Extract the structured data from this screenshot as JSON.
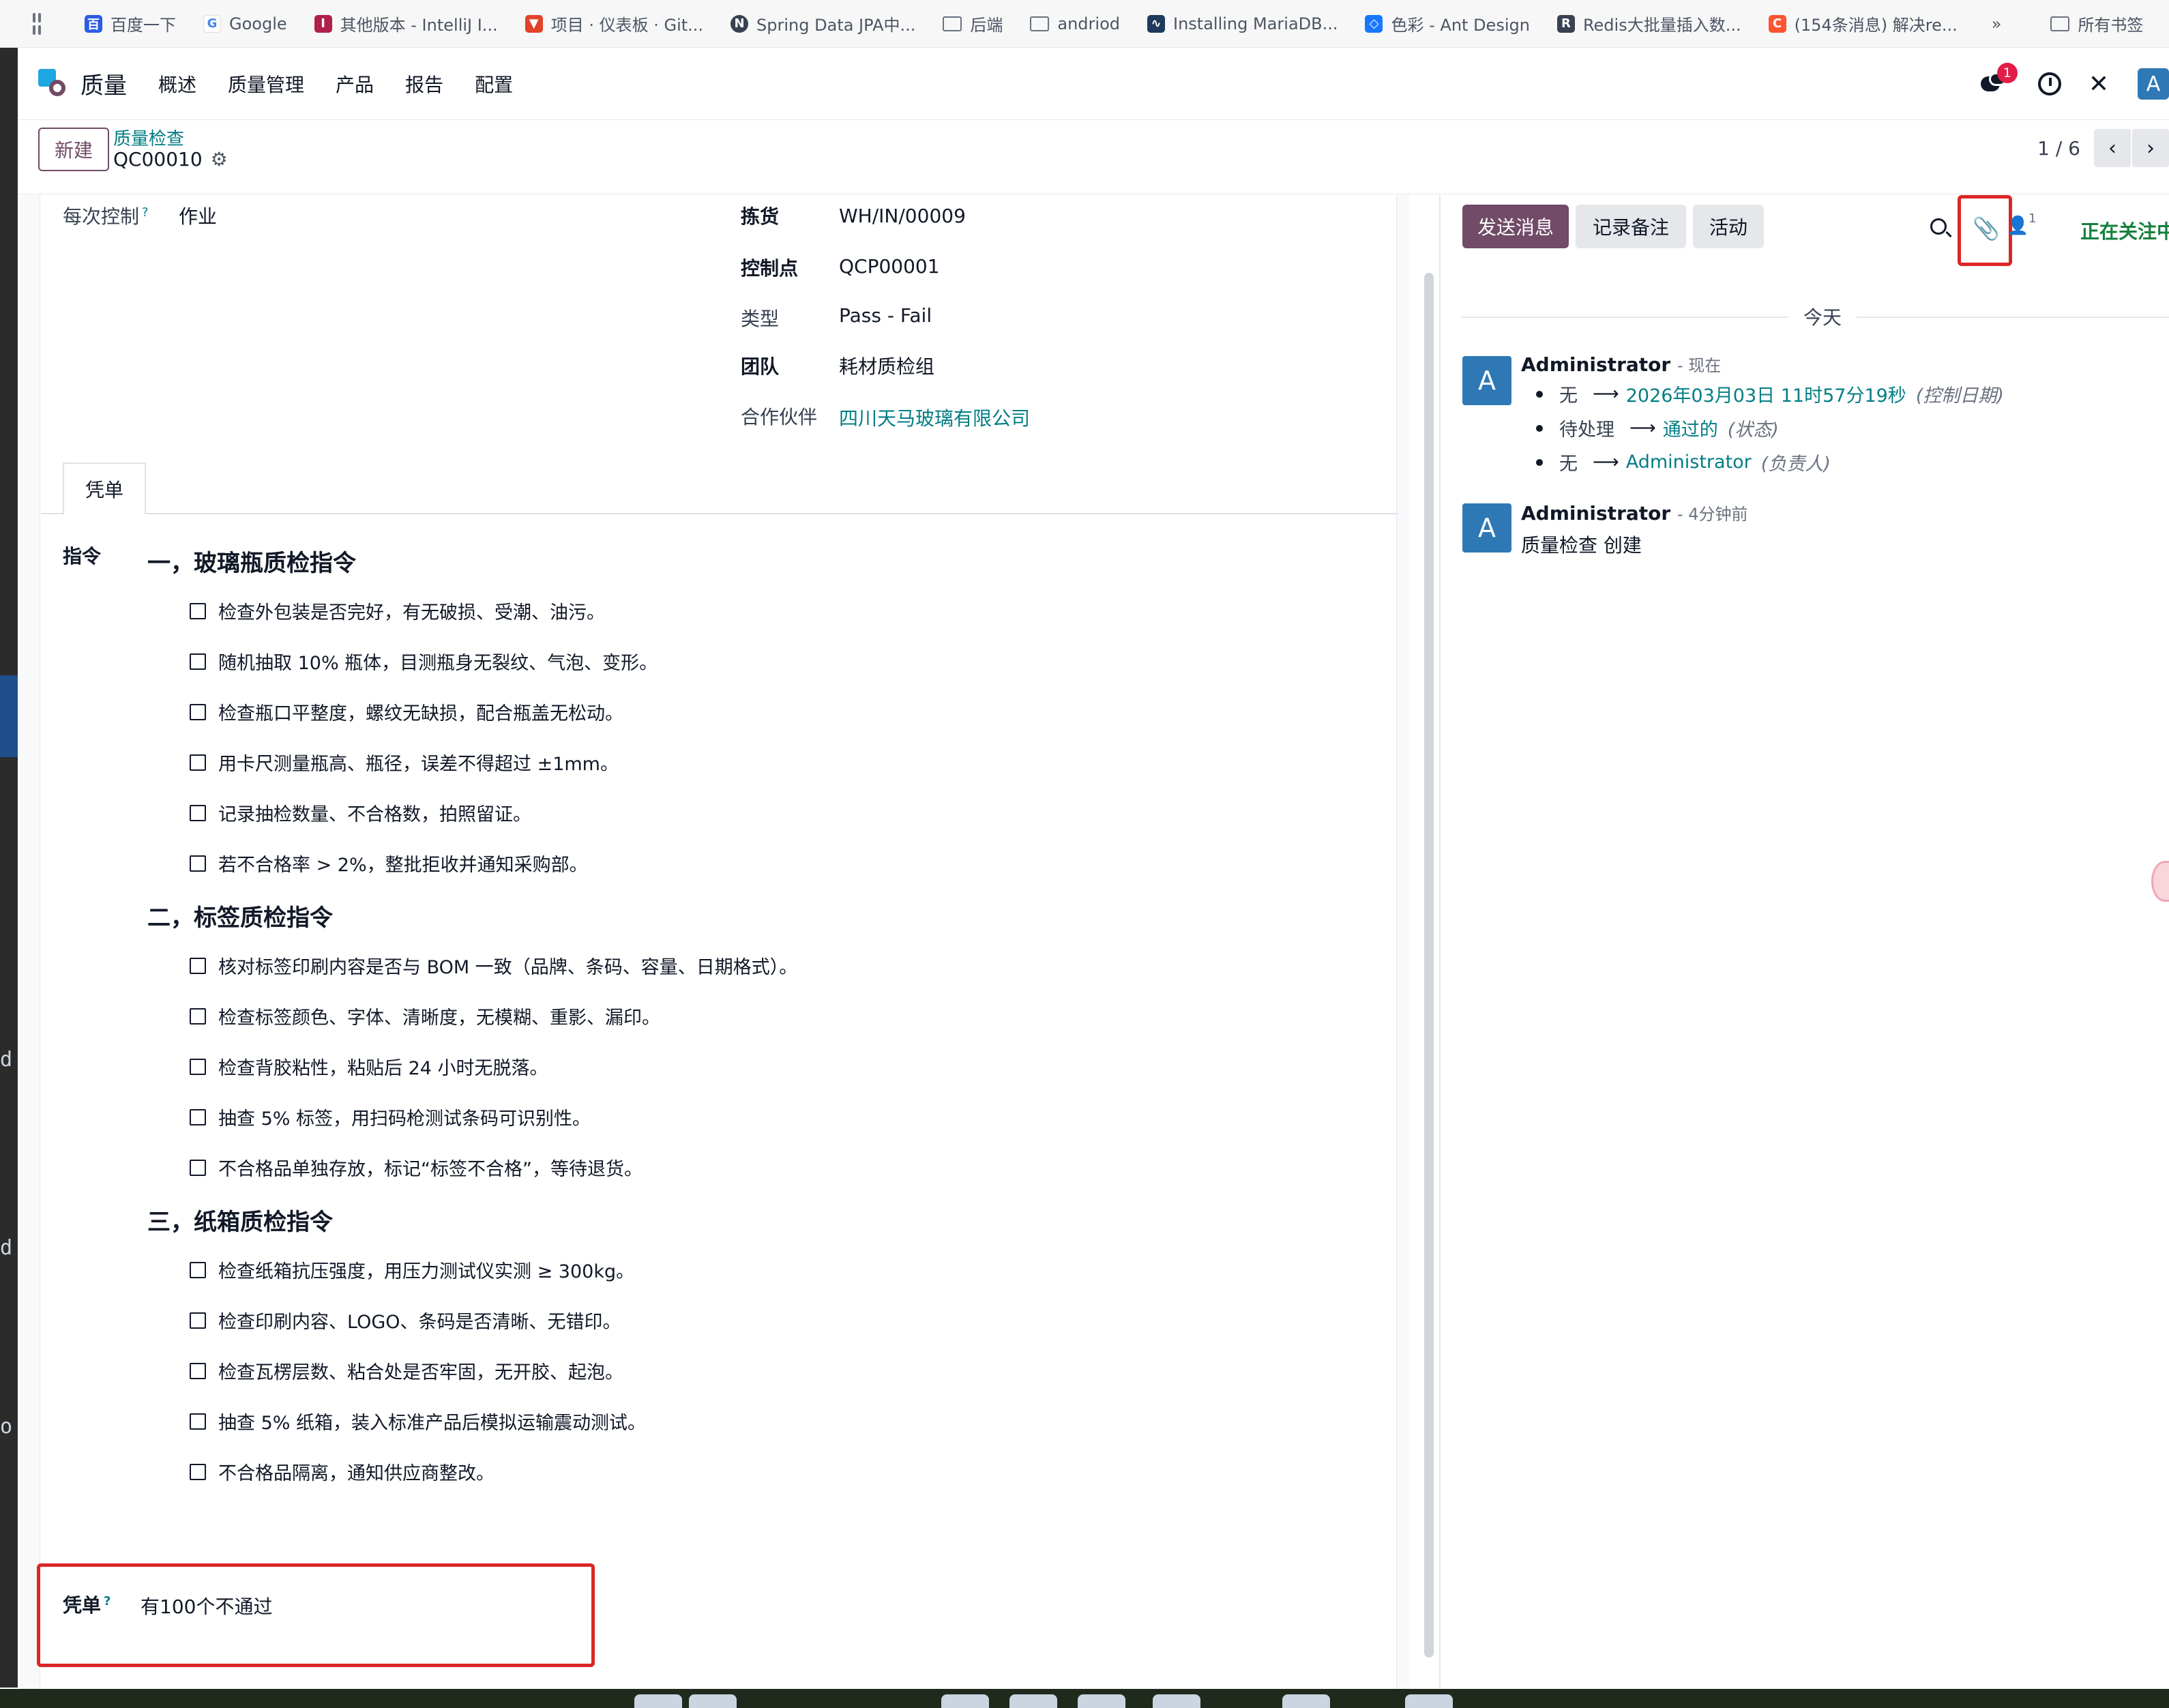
{
  "bookmarks": [
    {
      "label": "百度一下",
      "icon": "baidu-icon",
      "color": "#2b5ce6"
    },
    {
      "label": "Google",
      "icon": "google-icon",
      "color": "#4285f4"
    },
    {
      "label": "其他版本 - IntelliJ I...",
      "icon": "intellij-icon",
      "color": "#b0204a"
    },
    {
      "label": "项目 · 仪表板 · Git...",
      "icon": "gitlab-icon",
      "color": "#e2432a"
    },
    {
      "label": "Spring Data JPA中...",
      "icon": "notion-icon",
      "color": "#374151"
    },
    {
      "label": "后端",
      "icon": "folder-icon",
      "color": "#6b7280"
    },
    {
      "label": "andriod",
      "icon": "folder-icon",
      "color": "#6b7280"
    },
    {
      "label": "Installing MariaDB...",
      "icon": "mariadb-icon",
      "color": "#1f3a5c"
    },
    {
      "label": "色彩 - Ant Design",
      "icon": "antd-icon",
      "color": "#1677ff"
    },
    {
      "label": "Redis大批量插入数...",
      "icon": "redis-icon",
      "color": "#374151"
    },
    {
      "label": "(154条消息) 解决re...",
      "icon": "csdn-icon",
      "color": "#fc5531"
    }
  ],
  "bookmarks_more": "»",
  "bookmarks_all": "所有书签",
  "navbar": {
    "app_name": "质量",
    "menu": [
      "概述",
      "质量管理",
      "产品",
      "报告",
      "配置"
    ],
    "chat_badge": "1",
    "avatar_letter": "A"
  },
  "control": {
    "new_button": "新建",
    "breadcrumb_parent": "质量检查",
    "record_name": "QC00010",
    "pager": "1 / 6"
  },
  "form": {
    "control_per_label": "每次控制",
    "control_per_value": "作业",
    "picking_label": "拣货",
    "picking_value": "WH/IN/00009",
    "control_point_label": "控制点",
    "control_point_value": "QCP00001",
    "type_label": "类型",
    "type_value": "Pass - Fail",
    "team_label": "团队",
    "team_value": "耗材质检组",
    "partner_label": "合作伙伴",
    "partner_value": "四川天马玻璃有限公司",
    "tab_label": "凭单",
    "instructions_label": "指令",
    "sections": [
      {
        "title": "一，玻璃瓶质检指令",
        "items": [
          "检查外包装是否完好，有无破损、受潮、油污。",
          "随机抽取 10% 瓶体，目测瓶身无裂纹、气泡、变形。",
          "检查瓶口平整度，螺纹无缺损，配合瓶盖无松动。",
          "用卡尺测量瓶高、瓶径，误差不得超过 ±1mm。",
          "记录抽检数量、不合格数，拍照留证。",
          "若不合格率 > 2%，整批拒收并通知采购部。"
        ]
      },
      {
        "title": "二，标签质检指令",
        "items": [
          "核对标签印刷内容是否与 BOM 一致（品牌、条码、容量、日期格式）。",
          "检查标签颜色、字体、清晰度，无模糊、重影、漏印。",
          "检查背胶粘性，粘贴后 24 小时无脱落。",
          "抽查 5% 标签，用扫码枪测试条码可识别性。",
          "不合格品单独存放，标记“标签不合格”，等待退货。"
        ]
      },
      {
        "title": "三，纸箱质检指令",
        "items": [
          "检查纸箱抗压强度，用压力测试仪实测 ≥ 300kg。",
          "检查印刷内容、LOGO、条码是否清晰、无错印。",
          "检查瓦楞层数、粘合处是否牢固，无开胶、起泡。",
          "抽查 5% 纸箱，装入标准产品后模拟运输震动测试。",
          "不合格品隔离，通知供应商整改。"
        ]
      }
    ],
    "note_label": "凭单",
    "note_value": "有100个不通过"
  },
  "chatter": {
    "send_message": "发送消息",
    "log_note": "记录备注",
    "activity": "活动",
    "follower_count": "1",
    "following": "正在关注中",
    "today": "今天",
    "messages": [
      {
        "author": "Administrator",
        "time": "- 现在",
        "avatar": "A",
        "tracking": [
          {
            "old": "无",
            "new": "2026年03月03日 11时57分19秒",
            "field": "(控制日期)"
          },
          {
            "old": "待处理",
            "new": "通过的",
            "field": "(状态)"
          },
          {
            "old": "无",
            "new": "Administrator",
            "field": "(负责人)"
          }
        ]
      },
      {
        "author": "Administrator",
        "time": "- 4分钟前",
        "avatar": "A",
        "body": "质量检查 创建"
      }
    ]
  },
  "colors": {
    "primary": "#714b67",
    "link": "#017e84",
    "highlight": "#dc2626",
    "following": "#15803d"
  }
}
